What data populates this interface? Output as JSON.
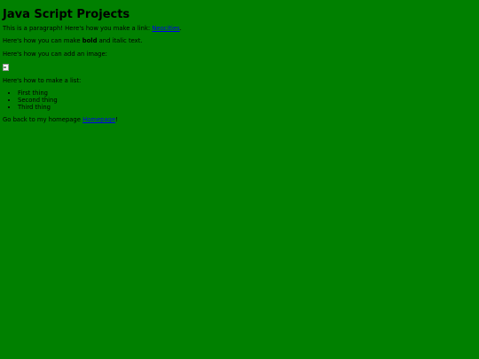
{
  "heading": "Java Script Projects",
  "para1": {
    "text_before": "This is a paragraph! Here's how you make a link: ",
    "link_label": "Neocities",
    "text_after": "."
  },
  "para2": {
    "text_before": "Here's how you can make ",
    "bold": "bold",
    "text_after": " and italic text."
  },
  "para3": "Here's how you can add an image:",
  "image": {
    "icon": "broken-image-icon"
  },
  "para4": "Here's how to make a list:",
  "list": [
    "First thing",
    "Second thing",
    "Third thing"
  ],
  "para5": {
    "text_before": "Go back to my homepage ",
    "link_label": "Homepage",
    "text_after": "!"
  },
  "colors": {
    "background": "#008000",
    "link": "#0000ee",
    "text": "#000000"
  }
}
